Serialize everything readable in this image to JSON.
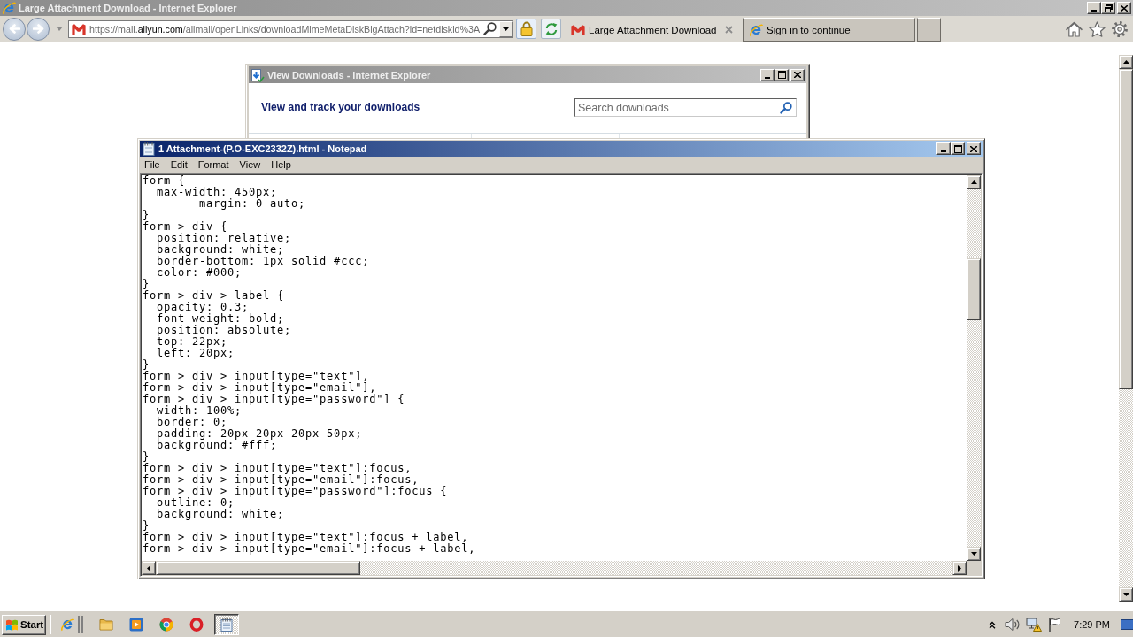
{
  "browser": {
    "title": "Large Attachment Download - Internet Explorer",
    "active": false,
    "address": {
      "before_domain": "https://mail.",
      "domain": "aliyun.com",
      "after_domain": "/alimail/openLinks/downloadMimeMetaDiskBigAttach?id=netdiskid%3A"
    },
    "tabs": [
      {
        "label": "Large Attachment Download",
        "kind": "mail",
        "selected": true
      },
      {
        "label": "Sign in to continue",
        "kind": "ie",
        "selected": false
      }
    ]
  },
  "downloads_window": {
    "title": "View Downloads - Internet Explorer",
    "active": false,
    "heading": "View and track your downloads",
    "search": {
      "placeholder": "Search downloads"
    }
  },
  "notepad": {
    "title": "1 Attachment-(P.O-EXC2332Z).html - Notepad",
    "active": true,
    "menu": [
      "File",
      "Edit",
      "Format",
      "View",
      "Help"
    ],
    "lines": [
      "form {",
      "  max-width: 450px;",
      "        margin: 0 auto;",
      "}",
      "form > div {",
      "  position: relative;",
      "  background: white;",
      "  border-bottom: 1px solid #ccc;",
      "  color: #000;",
      "}",
      "form > div > label {",
      "  opacity: 0.3;",
      "  font-weight: bold;",
      "  position: absolute;",
      "  top: 22px;",
      "  left: 20px;",
      "}",
      "form > div > input[type=\"text\"],",
      "form > div > input[type=\"email\"],",
      "form > div > input[type=\"password\"] {",
      "  width: 100%;",
      "  border: 0;",
      "  padding: 20px 20px 20px 50px;",
      "  background: #fff;",
      "}",
      "form > div > input[type=\"text\"]:focus,",
      "form > div > input[type=\"email\"]:focus,",
      "form > div > input[type=\"password\"]:focus {",
      "  outline: 0;",
      "  background: white;",
      "}",
      "form > div > input[type=\"text\"]:focus + label,",
      "form > div > input[type=\"email\"]:focus + label,"
    ]
  },
  "taskbar": {
    "start": "Start",
    "apps": [
      {
        "kind": "ie",
        "selected": false
      },
      {
        "kind": "folder",
        "selected": false
      },
      {
        "kind": "media",
        "selected": false
      },
      {
        "kind": "chrome",
        "selected": false
      },
      {
        "kind": "opera",
        "selected": false
      },
      {
        "kind": "notepad",
        "selected": true
      }
    ],
    "clock": "7:29 PM"
  }
}
